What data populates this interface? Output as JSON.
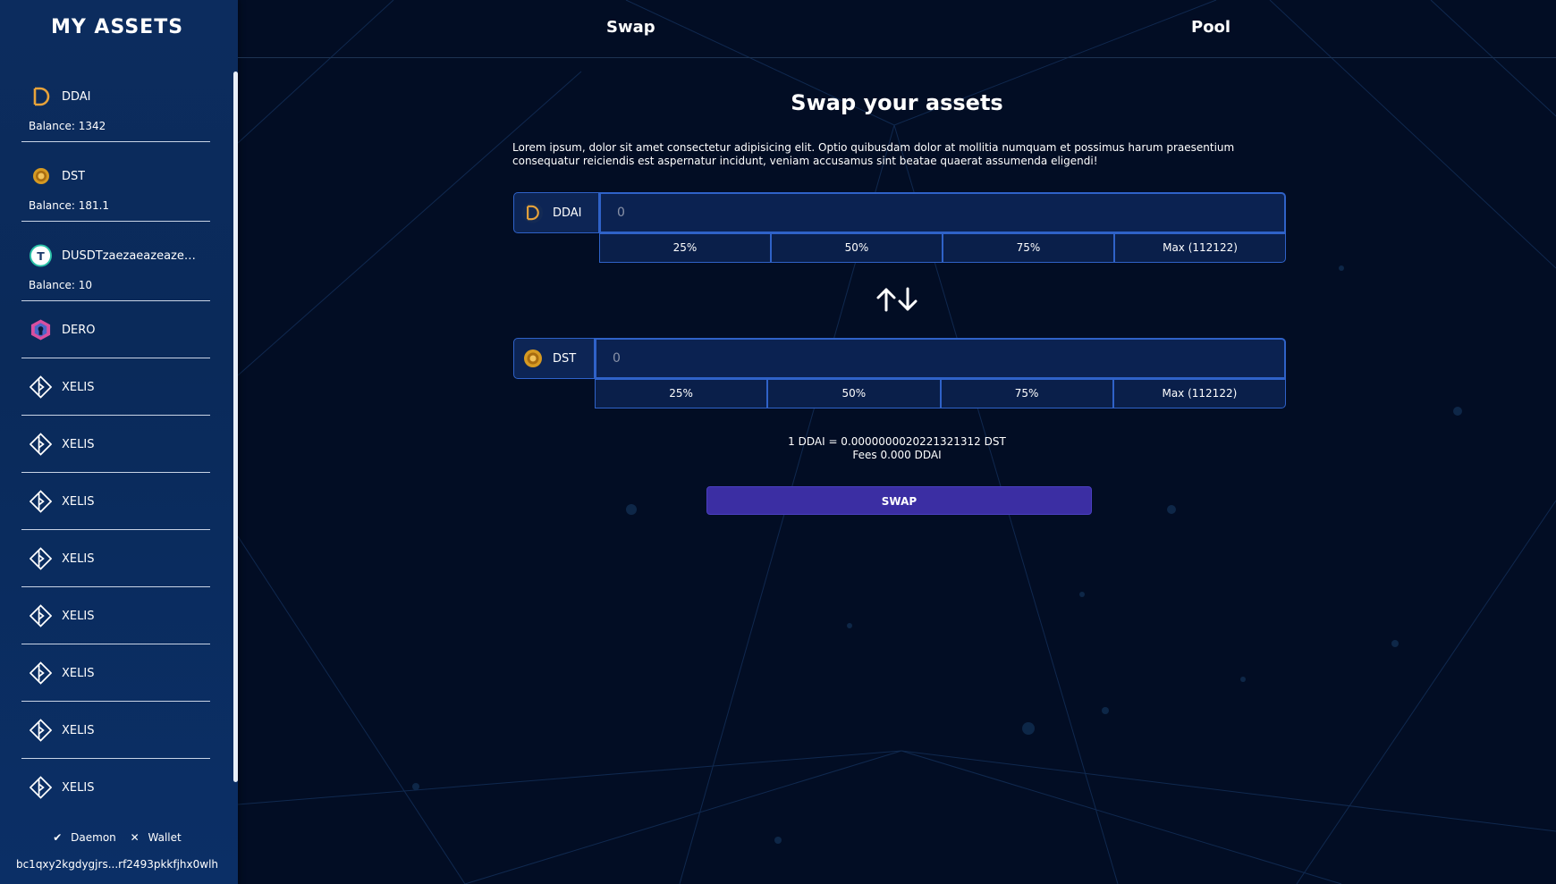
{
  "sidebar": {
    "title": "MY ASSETS",
    "assets": [
      {
        "name": "DDAI",
        "balance": "Balance: 1342",
        "icon": "ddai-icon"
      },
      {
        "name": "DST",
        "balance": "Balance: 181.1",
        "icon": "dst-coin-icon"
      },
      {
        "name": "DUSDTzaezaeazeazeazeazeaze",
        "balance": "Balance: 10",
        "icon": "tether-icon"
      },
      {
        "name": "DERO",
        "icon": "dero-icon"
      },
      {
        "name": "XELIS",
        "icon": "xelis-icon"
      },
      {
        "name": "XELIS",
        "icon": "xelis-icon"
      },
      {
        "name": "XELIS",
        "icon": "xelis-icon"
      },
      {
        "name": "XELIS",
        "icon": "xelis-icon"
      },
      {
        "name": "XELIS",
        "icon": "xelis-icon"
      },
      {
        "name": "XELIS",
        "icon": "xelis-icon"
      },
      {
        "name": "XELIS",
        "icon": "xelis-icon"
      },
      {
        "name": "XELIS",
        "icon": "xelis-icon"
      }
    ],
    "status": {
      "daemon_icon": "✔",
      "daemon": "Daemon",
      "wallet_icon": "✕",
      "wallet": "Wallet"
    },
    "address": "bc1qxy2kgdygjrs...rf2493pkkfjhx0wlh"
  },
  "nav": {
    "tabs": [
      "Swap",
      "Pool"
    ]
  },
  "main": {
    "heading": "Swap your assets",
    "description": "Lorem ipsum, dolor sit amet consectetur adipisicing elit. Optio quibusdam dolor at mollitia numquam et possimus harum praesentium consequatur reiciendis est aspernatur incidunt, veniam accusamus sint beatae quaerat assumenda eligendi!",
    "from": {
      "token": "DDAI",
      "icon": "ddai-icon",
      "amount_placeholder": "0",
      "percentages": [
        "25%",
        "50%",
        "75%",
        "Max (112122)"
      ]
    },
    "to": {
      "token": "DST",
      "icon": "dst-coin-icon",
      "amount_placeholder": "0",
      "percentages": [
        "25%",
        "50%",
        "75%",
        "Max (112122)"
      ]
    },
    "rate": "1 DDAI = 0.0000000020221321312 DST",
    "fees": "Fees 0.000 DDAI",
    "swap_label": "SWAP"
  },
  "colors": {
    "accent": "#2f62c8",
    "swap_button": "#3b2ea3",
    "background": "#020d24",
    "sidebar": "#0c2c5e"
  }
}
